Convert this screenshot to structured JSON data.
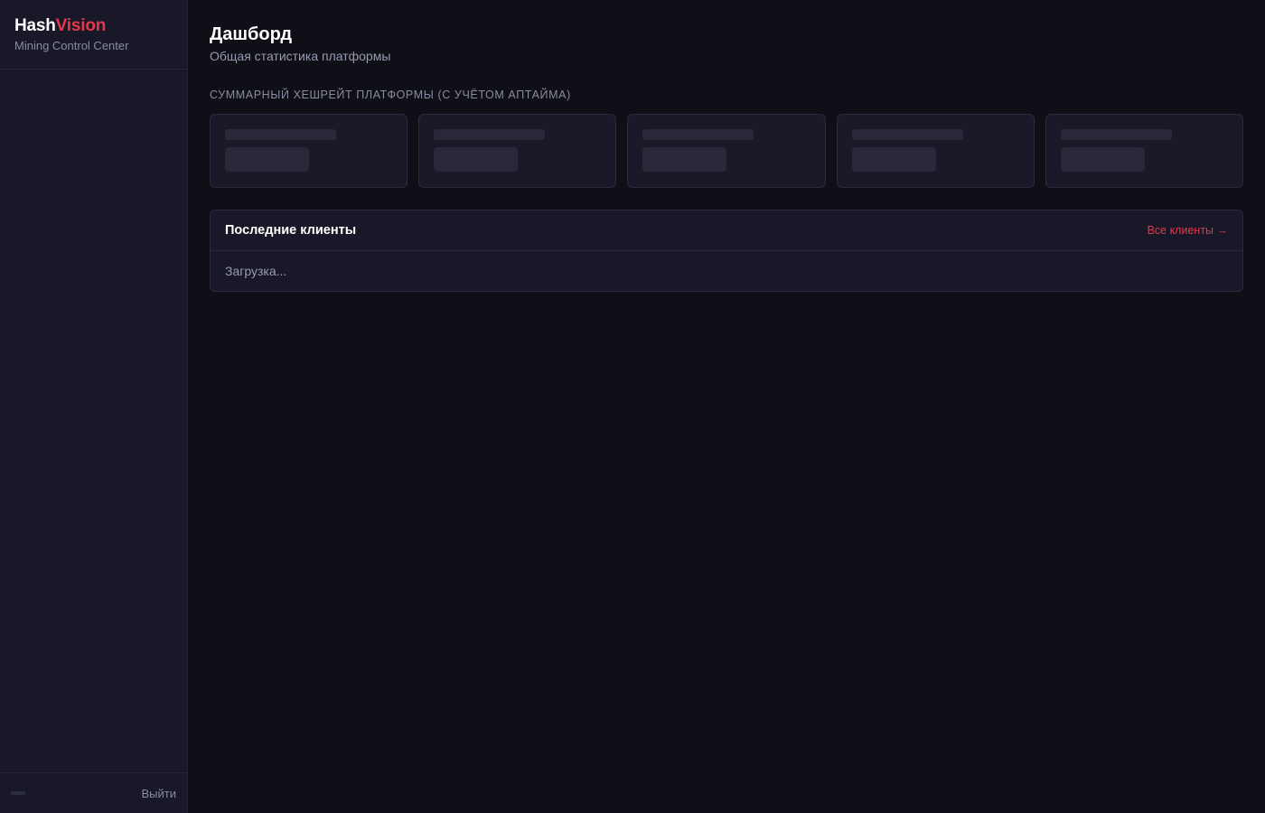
{
  "brand": {
    "name_part1": "Hash",
    "name_part2": "Vision",
    "subtitle": "Mining Control Center",
    "accent_color": "#e5384b"
  },
  "sidebar": {
    "logout_label": "Выйти"
  },
  "page": {
    "title": "Дашборд",
    "subtitle": "Общая статистика платформы"
  },
  "hashrate_section": {
    "label": "Суммарный хешрейт платформы (с учётом аптайма)",
    "cards_state": "loading"
  },
  "recent_clients": {
    "title": "Последние клиенты",
    "all_link": "Все клиенты →",
    "status": "Загрузка..."
  }
}
